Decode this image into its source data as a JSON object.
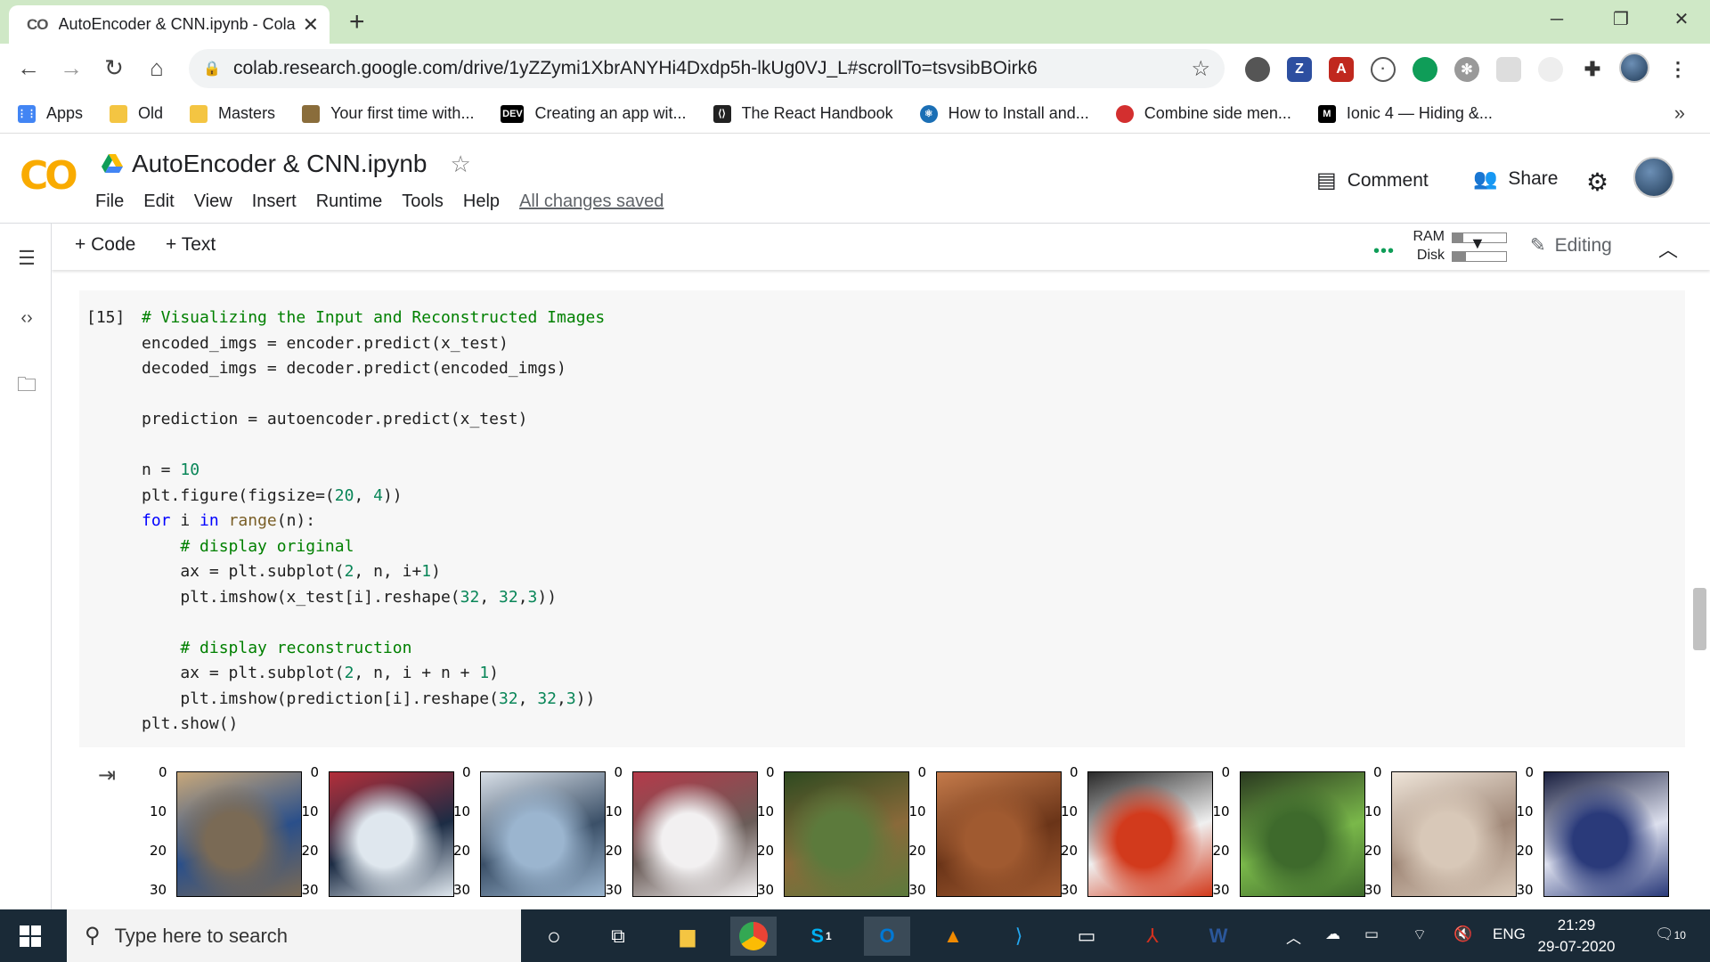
{
  "browser": {
    "tab_title": "AutoEncoder & CNN.ipynb - Cola",
    "favicon_text": "CO",
    "url": "colab.research.google.com/drive/1yZZymi1XbrANYHi4Dxdp5h-lkUg0VJ_L#scrollTo=tsvsibBOirk6",
    "bookmarks": [
      {
        "label": "Apps",
        "icon": "apps-grid-icon",
        "color": "#4285f4"
      },
      {
        "label": "Old",
        "icon": "folder-icon",
        "color": "#f4c542"
      },
      {
        "label": "Masters",
        "icon": "folder-icon",
        "color": "#f4c542"
      },
      {
        "label": "Your first time with...",
        "icon": "site-icon",
        "color": "#8a6d3b"
      },
      {
        "label": "Creating an app wit...",
        "icon": "dev-icon",
        "color": "#000000"
      },
      {
        "label": "The React Handbook",
        "icon": "flavio-icon",
        "color": "#222222"
      },
      {
        "label": "How to Install and...",
        "icon": "react-icon",
        "color": "#1b6fb5"
      },
      {
        "label": "Combine side men...",
        "icon": "site-icon",
        "color": "#d32f2f"
      },
      {
        "label": "Ionic 4 — Hiding &...",
        "icon": "medium-icon",
        "color": "#000000"
      }
    ],
    "bookmarks_more": "»"
  },
  "colab": {
    "logo": "CO",
    "notebook_title": "AutoEncoder & CNN.ipynb",
    "menu": [
      "File",
      "Edit",
      "View",
      "Insert",
      "Runtime",
      "Tools",
      "Help"
    ],
    "saved_status": "All changes saved",
    "comment_label": "Comment",
    "share_label": "Share",
    "add_code_label": "+ Code",
    "add_text_label": "+ Text",
    "ram_label": "RAM",
    "disk_label": "Disk",
    "ram_usage": 0.2,
    "disk_usage": 0.25,
    "editing_label": "Editing"
  },
  "cell": {
    "execution_count": "[15]",
    "code_lines": [
      "# Visualizing the Input and Reconstructed Images",
      "encoded_imgs = encoder.predict(x_test)",
      "decoded_imgs = decoder.predict(encoded_imgs)",
      "",
      "prediction = autoencoder.predict(x_test)",
      "",
      "n = 10",
      "plt.figure(figsize=(20, 4))",
      "for i in range(n):",
      "    # display original",
      "    ax = plt.subplot(2, n, i+1)",
      "    plt.imshow(x_test[i].reshape(32, 32,3))",
      "",
      "    # display reconstruction",
      "    ax = plt.subplot(2, n, i + n + 1)",
      "    plt.imshow(prediction[i].reshape(32, 32,3))",
      "plt.show()"
    ]
  },
  "output": {
    "y_ticks": [
      "0",
      "10",
      "20",
      "30"
    ],
    "images": [
      {
        "subject": "cat",
        "colors": [
          "#7a6a55",
          "#2a4f8a",
          "#c8a87a"
        ]
      },
      {
        "subject": "ship",
        "colors": [
          "#dfe7ee",
          "#1c2c44",
          "#b22e3a"
        ]
      },
      {
        "subject": "ship",
        "colors": [
          "#9bb5cf",
          "#3b5068",
          "#d7dee6"
        ]
      },
      {
        "subject": "airplane",
        "colors": [
          "#f2f0f1",
          "#6a5c58",
          "#b43a4a"
        ]
      },
      {
        "subject": "frog",
        "colors": [
          "#5c7a3c",
          "#8a6a3a",
          "#2e4a20"
        ]
      },
      {
        "subject": "frog",
        "colors": [
          "#a05a30",
          "#6a3418",
          "#c47a4a"
        ]
      },
      {
        "subject": "automobile",
        "colors": [
          "#d23a1c",
          "#f0f0f0",
          "#2a2a2a"
        ]
      },
      {
        "subject": "frog",
        "colors": [
          "#3e6a2c",
          "#7ab84a",
          "#2a3a20"
        ]
      },
      {
        "subject": "cat",
        "colors": [
          "#d8c8b8",
          "#a08878",
          "#eee4d8"
        ]
      },
      {
        "subject": "automobile",
        "colors": [
          "#2a3a7a",
          "#dde0ee",
          "#1a2040"
        ]
      }
    ]
  },
  "taskbar": {
    "search_placeholder": "Type here to search",
    "language": "ENG",
    "time": "21:29",
    "date": "29-07-2020",
    "notifications": "10",
    "skype_badge": "1"
  }
}
